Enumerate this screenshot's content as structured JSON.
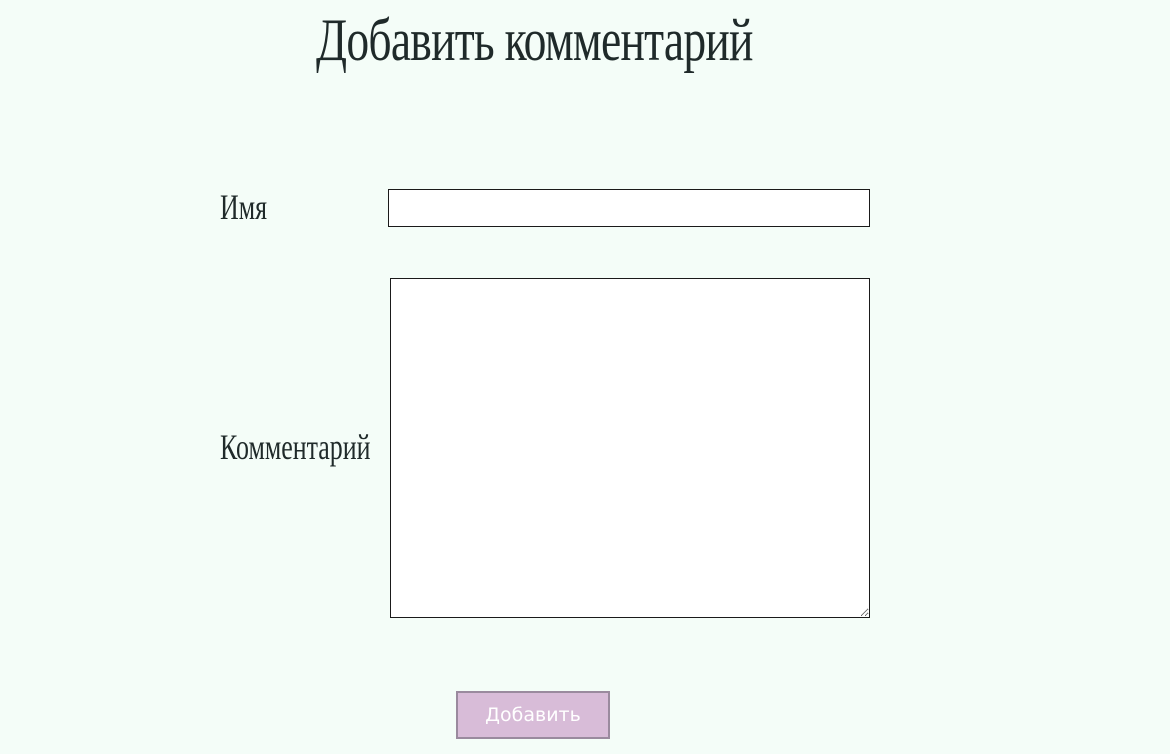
{
  "page": {
    "title": "Добавить комментарий"
  },
  "form": {
    "name_label": "Имя",
    "name_value": "",
    "comment_label": "Комментарий",
    "comment_value": "",
    "submit_label": "Добавить"
  },
  "colors": {
    "background": "#f4fdf8",
    "text": "#1f2a2a",
    "button_fill": "#d8bcd8",
    "button_border": "#9a8a9e",
    "button_text": "#ffffff"
  }
}
